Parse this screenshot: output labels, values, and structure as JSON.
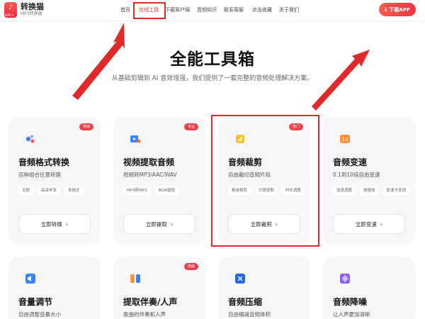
{
  "header": {
    "logo_title": "转换猫",
    "logo_sub": "MP3转换器",
    "logo_tag": "MP3.4",
    "nav": [
      "首页",
      "在线工具",
      "下载客户端",
      "音频知识",
      "联系客服",
      "点击收藏",
      "关于我们"
    ],
    "active_nav": "在线工具",
    "download_label": "下载APP"
  },
  "hero": {
    "title": "全能工具箱",
    "subtitle": "从基础剪辑到 AI 音效增强，我们提供了一套完整的音频处理解决方案。"
  },
  "cards": [
    {
      "title": "音频格式转换",
      "desc": "百种组合任意转换",
      "badge": "常用",
      "tags": [
        "无损",
        "高采样率",
        "多格式"
      ],
      "action": "立即转换",
      "icon": "format-convert-icon",
      "icon_color": "#4d7cff"
    },
    {
      "title": "视频提取音频",
      "desc": "视频转MP3/AAC/WAV",
      "badge": "专业",
      "tags": [
        "MP4转MP3",
        "BGM提取"
      ],
      "action": "立即提取",
      "icon": "video-audio-icon",
      "icon_color": "#3b82f6"
    },
    {
      "title": "音频裁剪",
      "desc": "自由裁切音频片段",
      "badge": "热门",
      "tags": [
        "精准裁剪",
        "片段提取",
        "时长调整"
      ],
      "action": "立即裁剪",
      "icon": "cut-icon",
      "icon_color": "#f59e0b"
    },
    {
      "title": "音频变速",
      "desc": "0.1到10倍自由变速",
      "badge": "",
      "tags": [
        "加速调整",
        "快慢放",
        "变速不变调"
      ],
      "action": "立即变速",
      "icon": "speed-icon",
      "icon_color": "#f97316"
    },
    {
      "title": "音量调节",
      "desc": "自由调整音量大小",
      "badge": "",
      "tags": [],
      "action": "",
      "icon": "volume-icon",
      "icon_color": "#3b82f6"
    },
    {
      "title": "提取伴奏/人声",
      "desc": "歌曲的伴奏和人声",
      "badge": "高级",
      "tags": [],
      "action": "",
      "icon": "vocal-icon",
      "icon_color": "#f97316"
    },
    {
      "title": "音频压缩",
      "desc": "自由缩减音频体积",
      "badge": "",
      "tags": [],
      "action": "",
      "icon": "compress-icon",
      "icon_color": "#3b82f6"
    },
    {
      "title": "音频降噪",
      "desc": "让人声更加清晰",
      "badge": "",
      "tags": [],
      "action": "",
      "icon": "denoise-icon",
      "icon_color": "#8b5cf6"
    }
  ],
  "colors": {
    "accent": "#e8434c",
    "annotation": "#e02a2a"
  }
}
